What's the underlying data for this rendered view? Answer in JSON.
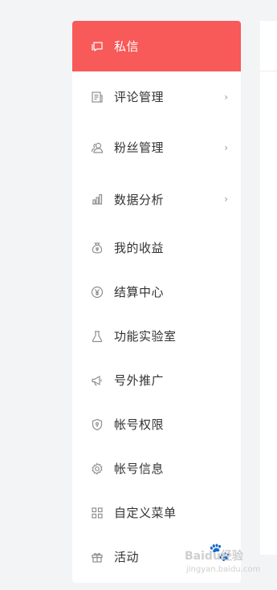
{
  "sidebar": {
    "items": [
      {
        "label": "私信",
        "icon": "message-icon",
        "active": true,
        "has_submenu": false
      },
      {
        "label": "评论管理",
        "icon": "comment-icon",
        "active": false,
        "has_submenu": true
      },
      {
        "label": "粉丝管理",
        "icon": "fans-icon",
        "active": false,
        "has_submenu": true
      },
      {
        "label": "数据分析",
        "icon": "bar-chart-icon",
        "active": false,
        "has_submenu": true
      },
      {
        "label": "我的收益",
        "icon": "money-bag-icon",
        "active": false,
        "has_submenu": false
      },
      {
        "label": "结算中心",
        "icon": "yen-icon",
        "active": false,
        "has_submenu": false
      },
      {
        "label": "功能实验室",
        "icon": "flask-icon",
        "active": false,
        "has_submenu": false
      },
      {
        "label": "号外推广",
        "icon": "megaphone-icon",
        "active": false,
        "has_submenu": false
      },
      {
        "label": "帐号权限",
        "icon": "shield-icon",
        "active": false,
        "has_submenu": false
      },
      {
        "label": "帐号信息",
        "icon": "gear-icon",
        "active": false,
        "has_submenu": false
      },
      {
        "label": "自定义菜单",
        "icon": "grid-icon",
        "active": false,
        "has_submenu": false
      },
      {
        "label": "活动",
        "icon": "gift-icon",
        "active": false,
        "has_submenu": false
      }
    ],
    "chevron": "›"
  },
  "watermark": {
    "brand": "Baidu经验",
    "url": "jingyan.baidu.com"
  },
  "colors": {
    "active_bg": "#f85959",
    "page_bg": "#f3f4f6",
    "text": "#333333",
    "icon": "#8f8f8f"
  }
}
